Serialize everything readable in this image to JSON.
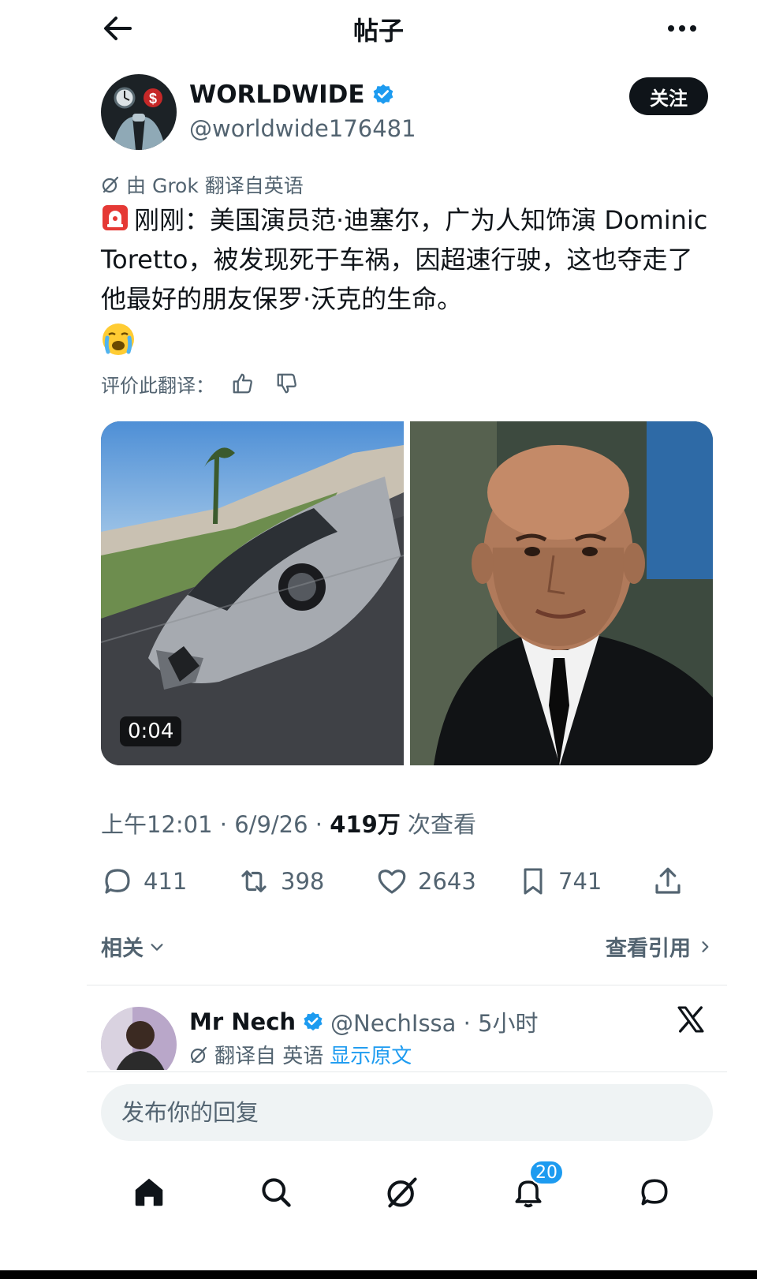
{
  "header": {
    "title": "帖子"
  },
  "author": {
    "name": "WORLDWIDE",
    "handle": "@worldwide176481",
    "follow_label": "关注"
  },
  "post": {
    "translated_by": "由 Grok 翻译自英语",
    "text": "刚刚：美国演员范·迪塞尔，广为人知饰演 Dominic Toretto，被发现死于车祸，因超速行驶，这也夺走了他最好的朋友保罗·沃克的生命。",
    "rate_label": "评价此翻译：",
    "video_duration": "0:04",
    "time": "上午12:01 · 6/9/26 · ",
    "views": "419万",
    "views_suffix": " 次查看"
  },
  "actions": {
    "replies": "411",
    "reposts": "398",
    "likes": "2643",
    "bookmarks": "741"
  },
  "related_label": "相关",
  "view_quotes_label": "查看引用",
  "reply": {
    "name": "Mr Nech",
    "handle": "@NechIssa · 5小时",
    "translated": "翻译自 英语",
    "show_original": "显示原文"
  },
  "reply_input": {
    "placeholder": "发布你的回复"
  },
  "nav": {
    "notifications_badge": "20"
  },
  "colors": {
    "accent": "#1d9bf0",
    "text": "#0f1419",
    "secondary": "#536471"
  },
  "icons": [
    "back-arrow-icon",
    "more-icon",
    "verified-icon",
    "grok-icon",
    "thumbs-up-icon",
    "thumbs-down-icon",
    "reply-icon",
    "repost-icon",
    "like-icon",
    "bookmark-icon",
    "share-icon",
    "chevron-down-icon",
    "chevron-right-icon",
    "x-logo-icon",
    "home-icon",
    "search-icon",
    "grok-nav-icon",
    "bell-icon",
    "messages-icon"
  ]
}
